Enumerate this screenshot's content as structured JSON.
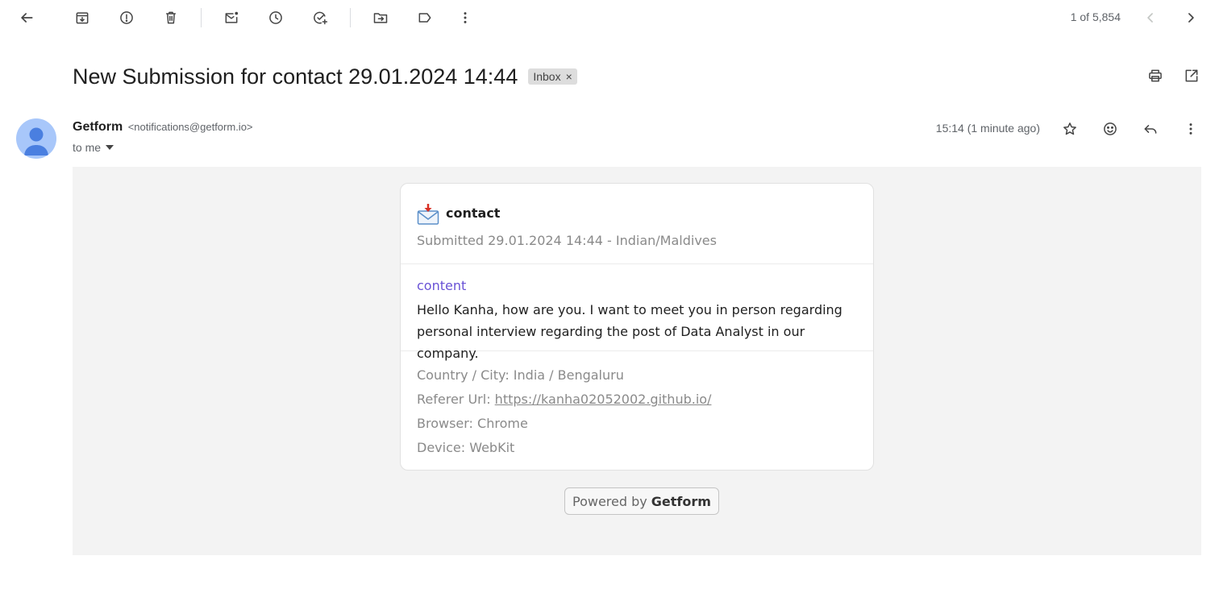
{
  "toolbar": {
    "icons": [
      "back-arrow-icon",
      "archive-icon",
      "report-spam-icon",
      "delete-icon",
      "mark-unread-icon",
      "snooze-icon",
      "add-to-tasks-icon",
      "move-to-icon",
      "label-icon",
      "more-vert-icon"
    ],
    "pager_text": "1 of 5,854"
  },
  "message": {
    "subject": "New Submission for contact 29.01.2024 14:44",
    "label": "Inbox",
    "label_remove": "×",
    "sender_name": "Getform",
    "sender_email": "<notifications@getform.io>",
    "recipient": "to me",
    "time": "15:14 (1 minute ago)"
  },
  "form": {
    "name": "contact",
    "submitted": "Submitted 29.01.2024 14:44 - Indian/Maldives",
    "field_name": "content",
    "field_value": "Hello Kanha, how are you. I want to meet you in person regarding personal interview regarding the post of Data Analyst in our company.",
    "country_city": "Country / City: India / Bengaluru",
    "referer_label": "Referer Url:",
    "referer_url": "https://kanha02052002.github.io/",
    "browser": "Browser: Chrome",
    "device": "Device: WebKit"
  },
  "footer": {
    "powered_prefix": "Powered by",
    "powered_brand": "Getform"
  },
  "colors": {
    "accent_purple": "#6952d6",
    "avatar_bg": "#a8c7fa",
    "avatar_fg": "#4a7fe0",
    "body_bg": "#f3f3f3"
  }
}
